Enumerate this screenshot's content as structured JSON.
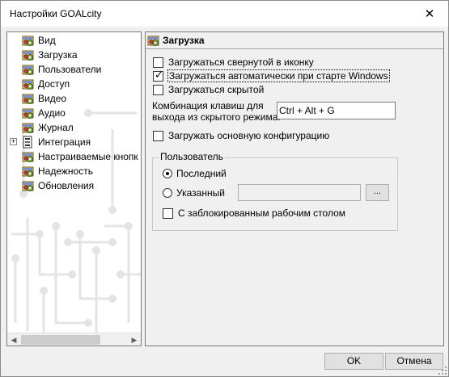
{
  "window": {
    "title": "Настройки GOALcity",
    "close_glyph": "✕"
  },
  "tree": {
    "items": [
      {
        "label": "Вид",
        "icon": "settings-gear-icon",
        "expandable": false
      },
      {
        "label": "Загрузка",
        "icon": "settings-gear-icon",
        "expandable": false
      },
      {
        "label": "Пользователи",
        "icon": "settings-gear-icon",
        "expandable": false
      },
      {
        "label": "Доступ",
        "icon": "settings-gear-icon",
        "expandable": false
      },
      {
        "label": "Видео",
        "icon": "settings-gear-icon",
        "expandable": false
      },
      {
        "label": "Аудио",
        "icon": "settings-gear-icon",
        "expandable": false
      },
      {
        "label": "Журнал",
        "icon": "settings-gear-icon",
        "expandable": false
      },
      {
        "label": "Интеграция",
        "icon": "integration-icon",
        "expandable": true,
        "expander_glyph": "+"
      },
      {
        "label": "Настраиваемые кнопк",
        "icon": "settings-gear-icon",
        "expandable": false
      },
      {
        "label": "Надежность",
        "icon": "settings-gear-icon",
        "expandable": false
      },
      {
        "label": "Обновления",
        "icon": "settings-gear-icon",
        "expandable": false
      }
    ],
    "scroll_left": "◀",
    "scroll_right": "▶"
  },
  "panel": {
    "header": "Загрузка",
    "options": [
      {
        "label": "Загружаться свернутой в иконку",
        "checked": false
      },
      {
        "label": "Загружаться автоматически при старте Windows",
        "checked": true
      },
      {
        "label": "Загружаться скрытой",
        "checked": false
      }
    ],
    "hotkey": {
      "label_line1": "Комбинация клавиш для",
      "label_line2": "выхода из скрытого режима:",
      "value": "Ctrl + Alt + G"
    },
    "main_config": {
      "label": "Загружать основную конфигурацию",
      "checked": false
    },
    "user_group": {
      "title": "Пользователь",
      "radio_last": "Последний",
      "radio_specified": "Указанный",
      "selected": "Последний",
      "browse_label": "...",
      "locked_desktop": {
        "label": "С заблокированным рабочим столом",
        "checked": false
      }
    }
  },
  "buttons": {
    "ok": "OK",
    "cancel": "Отмена"
  }
}
